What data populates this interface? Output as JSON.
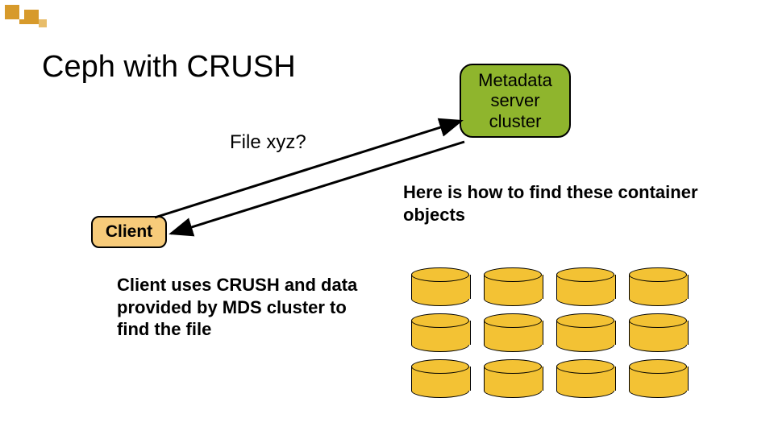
{
  "title": "Ceph with CRUSH",
  "query_label": "File xyz?",
  "client_label": "Client",
  "mds_label_l1": "Metadata",
  "mds_label_l2": "server",
  "mds_label_l3": "cluster",
  "response_text": "Here is how to find these container objects",
  "client_uses_text": "Client uses CRUSH and data provided  by MDS cluster to find the file",
  "drum_rows": 3,
  "drum_cols": 4,
  "colors": {
    "drum": "#f3c234",
    "mds": "#8fb52d",
    "client": "#f7cb7a",
    "motif": "#d79a2b"
  }
}
